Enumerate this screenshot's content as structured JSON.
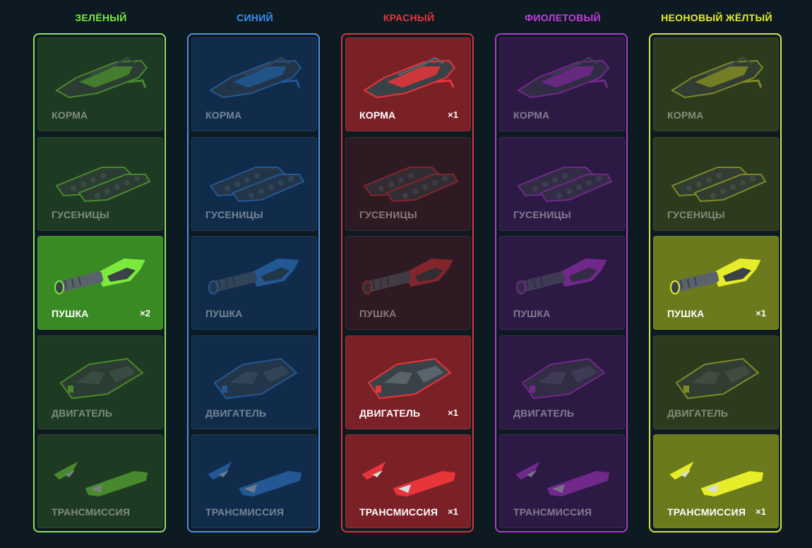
{
  "columns": [
    {
      "title": "ЗЕЛЁНЫЙ",
      "color": "#7bea3c",
      "frame": "#8ce35a",
      "bg": "#1f3a22",
      "owned_bg": "#3a8a24",
      "items": [
        {
          "label": "КОРМА",
          "count": "",
          "owned": false,
          "icon": "hull-icon"
        },
        {
          "label": "ГУСЕНИЦЫ",
          "count": "",
          "owned": false,
          "icon": "tracks-icon"
        },
        {
          "label": "ПУШКА",
          "count": "×2",
          "owned": true,
          "icon": "cannon-icon"
        },
        {
          "label": "ДВИГАТЕЛЬ",
          "count": "",
          "owned": false,
          "icon": "engine-icon"
        },
        {
          "label": "ТРАНСМИССИЯ",
          "count": "",
          "owned": false,
          "icon": "transmission-icon"
        }
      ]
    },
    {
      "title": "СИНИЙ",
      "color": "#3a8ef0",
      "frame": "#4f8fe0",
      "bg": "#102c4a",
      "owned_bg": "#1c4e86",
      "items": [
        {
          "label": "КОРМА",
          "count": "",
          "owned": false,
          "icon": "hull-icon"
        },
        {
          "label": "ГУСЕНИЦЫ",
          "count": "",
          "owned": false,
          "icon": "tracks-icon"
        },
        {
          "label": "ПУШКА",
          "count": "",
          "owned": false,
          "icon": "cannon-icon"
        },
        {
          "label": "ДВИГАТЕЛЬ",
          "count": "",
          "owned": false,
          "icon": "engine-icon"
        },
        {
          "label": "ТРАНСМИССИЯ",
          "count": "",
          "owned": false,
          "icon": "transmission-icon"
        }
      ]
    },
    {
      "title": "КРАСНЫЙ",
      "color": "#e8353a",
      "frame": "#d8343c",
      "bg": "#2e1a22",
      "owned_bg": "#7a2128",
      "items": [
        {
          "label": "КОРМА",
          "count": "×1",
          "owned": true,
          "icon": "hull-icon"
        },
        {
          "label": "ГУСЕНИЦЫ",
          "count": "",
          "owned": false,
          "icon": "tracks-icon"
        },
        {
          "label": "ПУШКА",
          "count": "",
          "owned": false,
          "icon": "cannon-icon"
        },
        {
          "label": "ДВИГАТЕЛЬ",
          "count": "×1",
          "owned": true,
          "icon": "engine-icon"
        },
        {
          "label": "ТРАНСМИССИЯ",
          "count": "×1",
          "owned": true,
          "icon": "transmission-icon"
        }
      ]
    },
    {
      "title": "ФИОЛЕТОВЫЙ",
      "color": "#c43ce0",
      "frame": "#b136d0",
      "bg": "#2c1a44",
      "owned_bg": "#55267a",
      "items": [
        {
          "label": "КОРМА",
          "count": "",
          "owned": false,
          "icon": "hull-icon"
        },
        {
          "label": "ГУСЕНИЦЫ",
          "count": "",
          "owned": false,
          "icon": "tracks-icon"
        },
        {
          "label": "ПУШКА",
          "count": "",
          "owned": false,
          "icon": "cannon-icon"
        },
        {
          "label": "ДВИГАТЕЛЬ",
          "count": "",
          "owned": false,
          "icon": "engine-icon"
        },
        {
          "label": "ТРАНСМИССИЯ",
          "count": "",
          "owned": false,
          "icon": "transmission-icon"
        }
      ]
    },
    {
      "title": "НЕОНОВЫЙ ЖЁЛТЫЙ",
      "color": "#e6ec2a",
      "frame": "#d8e24a",
      "bg": "#2c3a1e",
      "owned_bg": "#6a7a1c",
      "items": [
        {
          "label": "КОРМА",
          "count": "",
          "owned": false,
          "icon": "hull-icon"
        },
        {
          "label": "ГУСЕНИЦЫ",
          "count": "",
          "owned": false,
          "icon": "tracks-icon"
        },
        {
          "label": "ПУШКА",
          "count": "×1",
          "owned": true,
          "icon": "cannon-icon"
        },
        {
          "label": "ДВИГАТЕЛЬ",
          "count": "",
          "owned": false,
          "icon": "engine-icon"
        },
        {
          "label": "ТРАНСМИССИЯ",
          "count": "×1",
          "owned": true,
          "icon": "transmission-icon"
        }
      ]
    }
  ]
}
